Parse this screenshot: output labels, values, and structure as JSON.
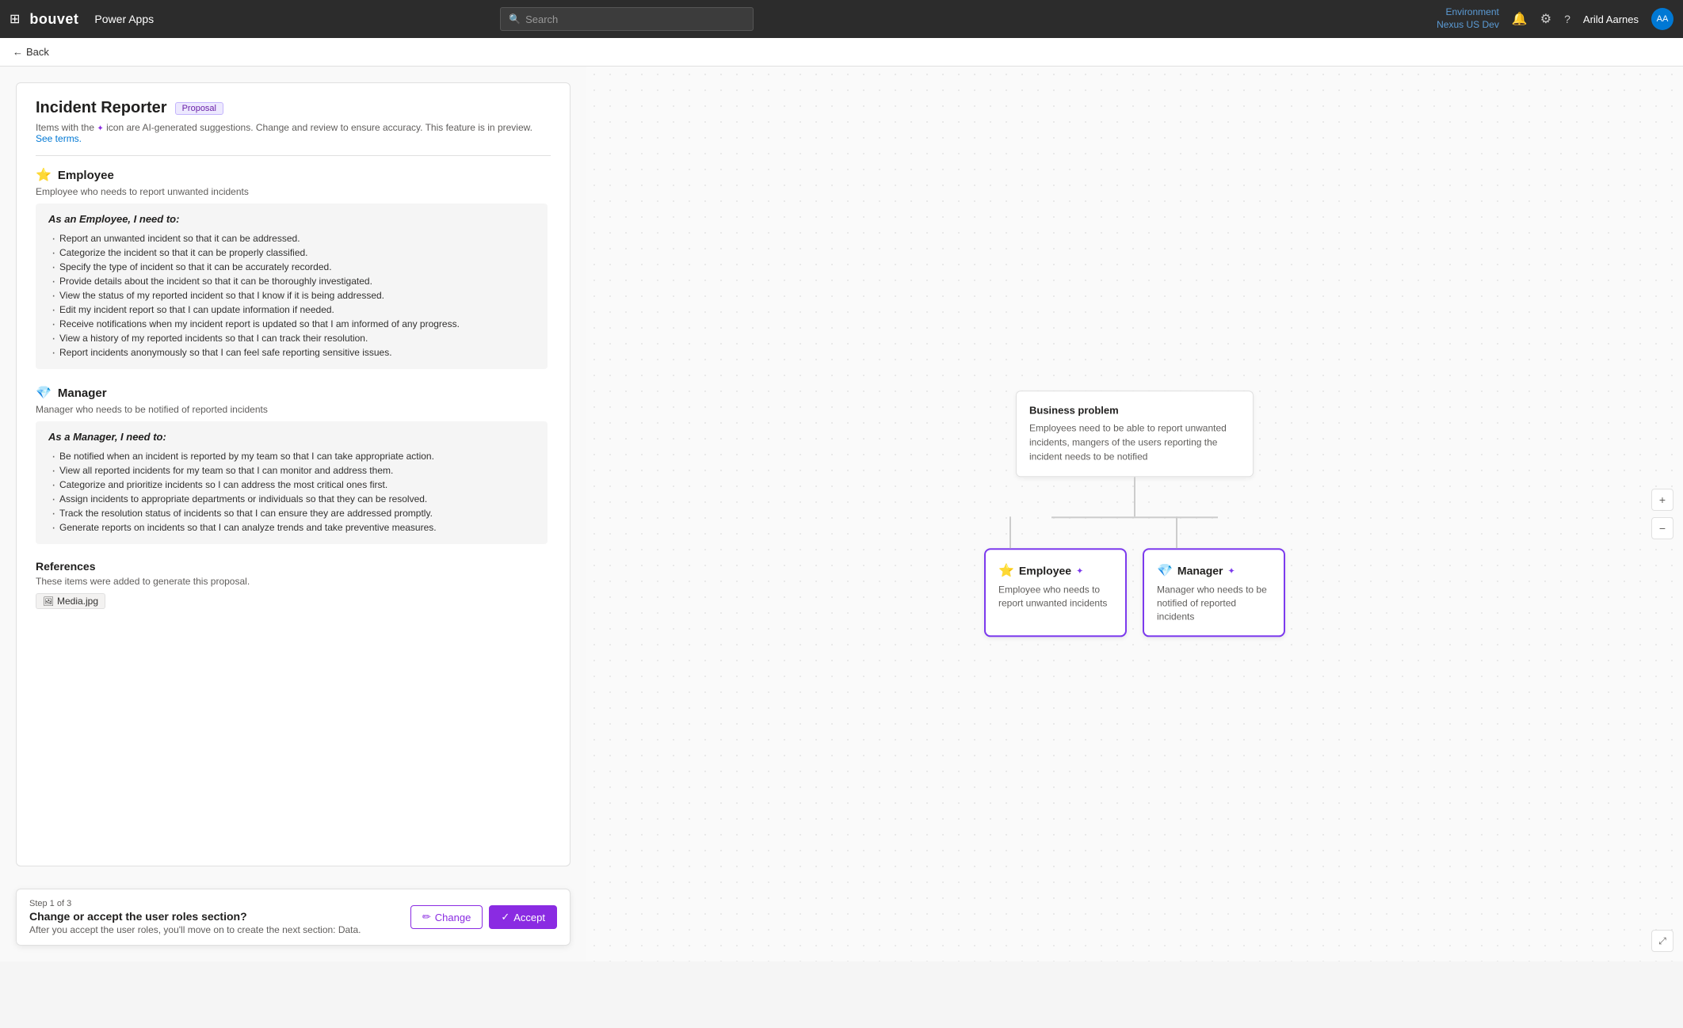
{
  "topNav": {
    "brand": "bouvet",
    "appName": "Power Apps",
    "search": {
      "placeholder": "Search"
    },
    "environment": {
      "label": "Environment",
      "name": "Nexus US Dev"
    },
    "userName": "Arild Aarnes"
  },
  "subNav": {
    "backLabel": "Back"
  },
  "proposal": {
    "title": "Incident Reporter",
    "badge": "Proposal",
    "subtitle": "Items with the ✦ icon are AI-generated suggestions. Change and review to ensure accuracy. This feature is in preview.",
    "subtitleLink": "See terms.",
    "employeeRole": {
      "name": "Employee",
      "subtitle": "Employee who needs to report unwanted incidents",
      "bodyTitle": "As an Employee, I need to:",
      "items": [
        "Report an unwanted incident so that it can be addressed.",
        "Categorize the incident so that it can be properly classified.",
        "Specify the type of incident so that it can be accurately recorded.",
        "Provide details about the incident so that it can be thoroughly investigated.",
        "View the status of my reported incident so that I know if it is being addressed.",
        "Edit my incident report so that I can update information if needed.",
        "Receive notifications when my incident report is updated so that I am informed of any progress.",
        "View a history of my reported incidents so that I can track their resolution.",
        "Report incidents anonymously so that I can feel safe reporting sensitive issues."
      ]
    },
    "managerRole": {
      "name": "Manager",
      "subtitle": "Manager who needs to be notified of reported incidents",
      "bodyTitle": "As a Manager, I need to:",
      "items": [
        "Be notified when an incident is reported by my team so that I can take appropriate action.",
        "View all reported incidents for my team so that I can monitor and address them.",
        "Categorize and prioritize incidents so I can address the most critical ones first.",
        "Assign incidents to appropriate departments or individuals so that they can be resolved.",
        "Track the resolution status of incidents so that I can ensure they are addressed promptly.",
        "Generate reports on incidents so that I can analyze trends and take preventive measures."
      ]
    },
    "references": {
      "title": "References",
      "subtitle": "These items were added to generate this proposal.",
      "tag": "Media.jpg"
    }
  },
  "actionBar": {
    "stepLabel": "Step 1 of 3",
    "stepTitle": "Change or accept the user roles section?",
    "stepDesc": "After you accept the user roles, you'll move on to create the next section: Data.",
    "changeLabel": "Change",
    "acceptLabel": "Accept"
  },
  "diagram": {
    "businessProblem": {
      "title": "Business problem",
      "description": "Employees need to be able to report unwanted incidents, mangers of the users reporting the incident needs to be notified"
    },
    "employeeCard": {
      "name": "Employee",
      "description": "Employee who needs to report unwanted incidents"
    },
    "managerCard": {
      "name": "Manager",
      "description": "Manager who needs to be notified of reported incidents"
    }
  },
  "icons": {
    "grid": "⊞",
    "search": "🔍",
    "bell": "🔔",
    "gear": "⚙",
    "help": "?",
    "back": "←",
    "employee": "⭐",
    "manager": "💎",
    "aiStar": "✦",
    "edit": "✏",
    "check": "✓",
    "plus": "+",
    "minus": "−",
    "resize": "⤢",
    "image": "🖼"
  }
}
